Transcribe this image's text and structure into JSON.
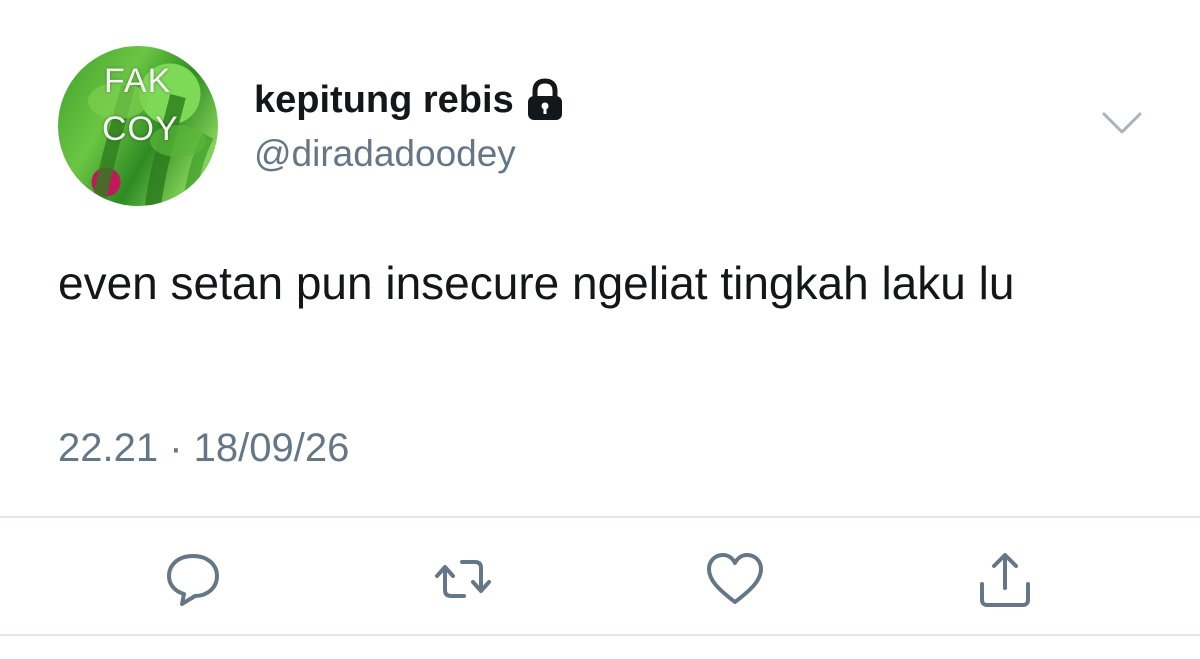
{
  "tweet": {
    "avatar": {
      "line1": "FAK",
      "line2": "COY"
    },
    "display_name": "kepitung rebis",
    "handle": "@diradadoodey",
    "text": "even setan pun insecure ngeliat tingkah laku lu",
    "timestamp": "22.21 · 18/09/26",
    "protected": true
  },
  "icons": {
    "lock": "lock-icon",
    "menu": "chevron-down-icon",
    "reply": "reply-icon",
    "retweet": "retweet-icon",
    "like": "heart-icon",
    "share": "share-icon"
  },
  "colors": {
    "text": "#14171a",
    "secondary": "#657786",
    "divider": "#e1e8ed",
    "icon": "#657786"
  }
}
